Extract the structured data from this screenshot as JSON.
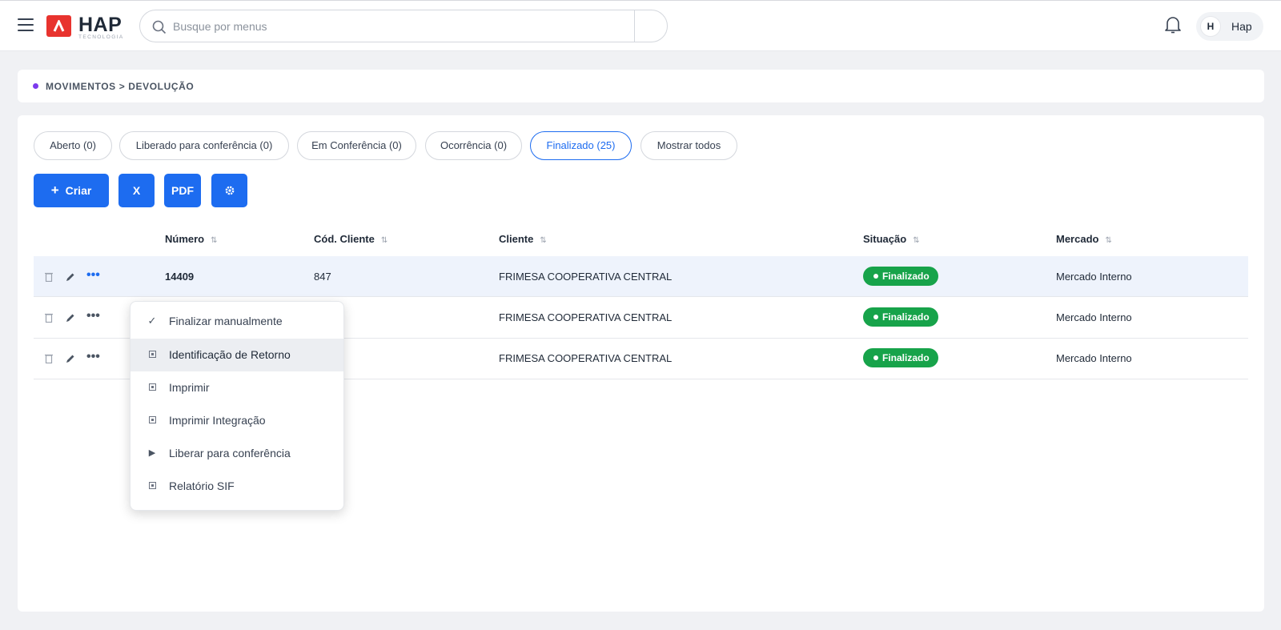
{
  "header": {
    "logo_text": "HAP",
    "logo_subtext": "TECNOLOGIA",
    "search_placeholder": "Busque por menus",
    "user_initial": "H",
    "user_name": "Hap"
  },
  "breadcrumb": "MOVIMENTOS > DEVOLUÇÃO",
  "tabs": [
    {
      "label": "Aberto (0)",
      "active": false
    },
    {
      "label": "Liberado para conferência (0)",
      "active": false
    },
    {
      "label": "Em Conferência (0)",
      "active": false
    },
    {
      "label": "Ocorrência (0)",
      "active": false
    },
    {
      "label": "Finalizado (25)",
      "active": true
    },
    {
      "label": "Mostrar todos",
      "active": false
    }
  ],
  "toolbar": {
    "create_label": "Criar",
    "excel_label": "X",
    "pdf_label": "PDF",
    "settings_icon": "gear-icon"
  },
  "table": {
    "columns": [
      "Número",
      "Cód. Cliente",
      "Cliente",
      "Situação",
      "Mercado"
    ],
    "rows": [
      {
        "numero": "14409",
        "cod_cliente": "847",
        "cliente": "FRIMESA COOPERATIVA CENTRAL",
        "situacao": "Finalizado",
        "mercado": "Mercado Interno"
      },
      {
        "numero": "",
        "cod_cliente": "",
        "cliente": "FRIMESA COOPERATIVA CENTRAL",
        "situacao": "Finalizado",
        "mercado": "Mercado Interno"
      },
      {
        "numero": "",
        "cod_cliente": "",
        "cliente": "FRIMESA COOPERATIVA CENTRAL",
        "situacao": "Finalizado",
        "mercado": "Mercado Interno"
      }
    ]
  },
  "context_menu": {
    "items": [
      {
        "label": "Finalizar manualmente",
        "icon": "check-icon"
      },
      {
        "label": "Identificação de Retorno",
        "icon": "document-icon"
      },
      {
        "label": "Imprimir",
        "icon": "document-icon"
      },
      {
        "label": "Imprimir Integração",
        "icon": "document-icon"
      },
      {
        "label": "Liberar para conferência",
        "icon": "play-icon"
      },
      {
        "label": "Relatório SIF",
        "icon": "document-icon"
      }
    ]
  },
  "colors": {
    "primary": "#1d6cf0",
    "success": "#17a34a",
    "brand_red": "#e8332e",
    "breadcrumb_dot": "#7c3aed"
  }
}
